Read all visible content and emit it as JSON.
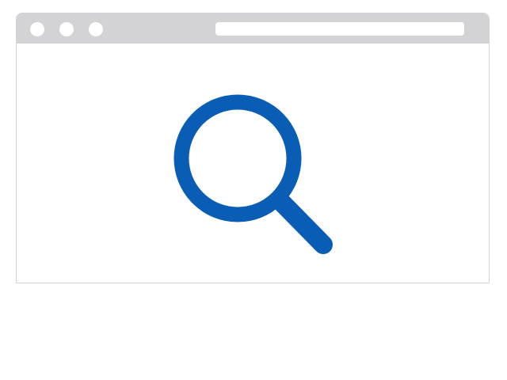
{
  "window": {
    "title_bar_color": "#d3d3d5",
    "dot_color": "#ffffff",
    "border_color": "#d3d3d5",
    "controls": [
      {
        "name": "window-control-1"
      },
      {
        "name": "window-control-2"
      },
      {
        "name": "window-control-3"
      }
    ]
  },
  "address_bar": {
    "value": "",
    "placeholder": ""
  },
  "content": {
    "icon": "magnifying-glass-icon",
    "icon_color": "#0a5db5"
  }
}
